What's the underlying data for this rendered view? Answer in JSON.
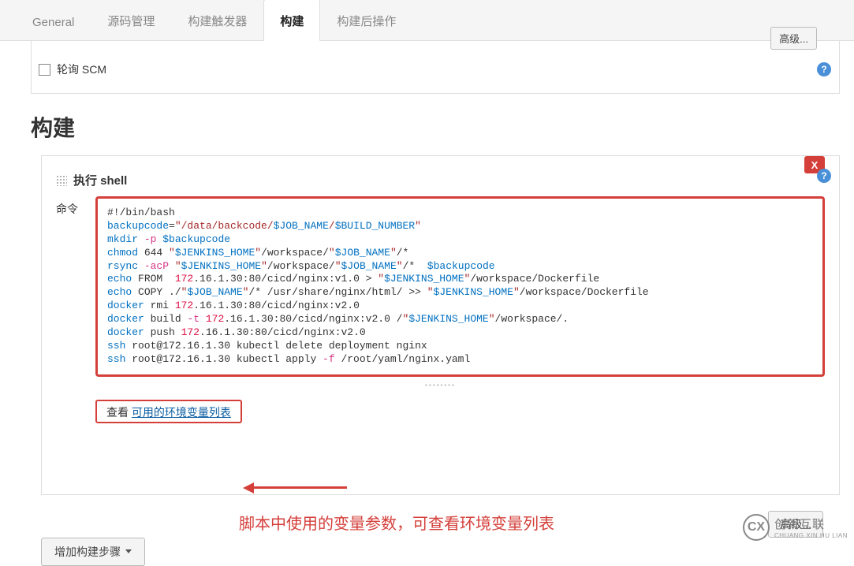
{
  "tabs": [
    "General",
    "源码管理",
    "构建触发器",
    "构建",
    "构建后操作"
  ],
  "active_tab_index": 3,
  "top_advanced_label": "高级...",
  "poll_scm_label": "轮询 SCM",
  "section_title": "构建",
  "build_step": {
    "title": "执行 shell",
    "cmd_label": "命令",
    "close_label": "X",
    "code_lines": [
      {
        "raw": "#!/bin/bash"
      },
      {
        "raw": "backupcode=\"/data/backcode/$JOB_NAME/$BUILD_NUMBER\""
      },
      {
        "raw": "mkdir -p $backupcode"
      },
      {
        "raw": "chmod 644 \"$JENKINS_HOME\"/workspace/\"$JOB_NAME\"/*"
      },
      {
        "raw": "rsync -acP \"$JENKINS_HOME\"/workspace/\"$JOB_NAME\"/*  $backupcode"
      },
      {
        "raw": "echo FROM  172.16.1.30:80/cicd/nginx:v1.0 > \"$JENKINS_HOME\"/workspace/Dockerfile"
      },
      {
        "raw": "echo COPY ./\"$JOB_NAME\"/* /usr/share/nginx/html/ >> \"$JENKINS_HOME\"/workspace/Dockerfile"
      },
      {
        "raw": "docker rmi 172.16.1.30:80/cicd/nginx:v2.0"
      },
      {
        "raw": "docker build -t 172.16.1.30:80/cicd/nginx:v2.0 /\"$JENKINS_HOME\"/workspace/."
      },
      {
        "raw": "docker push 172.16.1.30:80/cicd/nginx:v2.0"
      },
      {
        "raw": "ssh root@172.16.1.30 kubectl delete deployment nginx"
      },
      {
        "raw": "ssh root@172.16.1.30 kubectl apply -f /root/yaml/nginx.yaml"
      }
    ]
  },
  "see_prefix": "查看 ",
  "see_link": "可用的环境变量列表",
  "annotation": "脚本中使用的变量参数，可查看环境变量列表",
  "advanced2_label": "高级...",
  "add_step_label": "增加构建步骤",
  "watermark": {
    "cn": "创新互联",
    "en": "CHUANG XIN HU LIAN",
    "logo": "CX"
  }
}
